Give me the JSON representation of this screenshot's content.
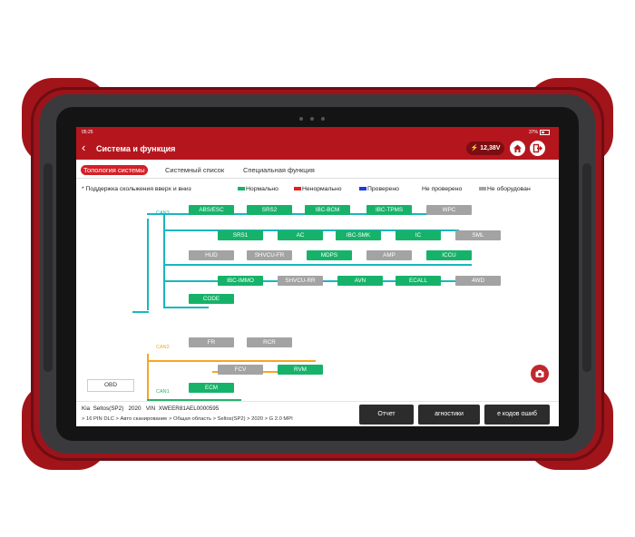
{
  "status": {
    "time": "05:25",
    "battery": "37%"
  },
  "header": {
    "title": "Система и функция",
    "voltage": "12,38V"
  },
  "tabs": [
    "Топология системы",
    "Системный список",
    "Специальная функция"
  ],
  "legend": {
    "hint": "* Поддержка скольжения вверх и вниз",
    "normal": "Нормально",
    "abnormal": "Ненормально",
    "checked": "Проверено",
    "unchecked": "Не проверено",
    "not_equipped": "Не оборудован"
  },
  "colors": {
    "normal": "#17b26a",
    "abnormal": "#e02020",
    "checked": "#1e3cd6",
    "not_equipped": "#a3a3a3",
    "accent": "#b5161e"
  },
  "bus": {
    "can3": "CAN3",
    "can2": "CAN2",
    "can1": "CAN1",
    "obd": "OBD"
  },
  "nodes": {
    "abs_esc": "ABS/ESC",
    "srs2": "SRS2",
    "ibc_bcm": "IBC-BCM",
    "ibc_tpms": "IBC-TPMS",
    "wpc": "WPC",
    "srs1": "SRS1",
    "ac": "AC",
    "ibc_smk": "IBC-SMK",
    "ic": "IC",
    "sml": "SML",
    "hud": "HUD",
    "shvcu_fr": "SHVCU-FR",
    "mdps": "MDPS",
    "amp": "AMP",
    "iccu": "ICCU",
    "ibc_immo": "IBC-IMMO",
    "shvcu_rr": "SHVCU-RR",
    "avn": "AVN",
    "ecall": "ECALL",
    "4wd": "4WD",
    "code": "CODE",
    "fr": "FR",
    "rcr": "RCR",
    "fcv": "FCV",
    "rvm": "RVM",
    "ecm": "ECM"
  },
  "vehicle": {
    "make": "Kia",
    "model": "Seltos(SP2)",
    "year": "2020",
    "vin_label": "VIN",
    "vin": "XWEER81AEL0000595"
  },
  "path": "> 16 PIN DLC > Авто сканирование > Общая область > Seltos(SP2) > 2020 > G 2.0 MPI",
  "buttons": {
    "report": "Отчет",
    "diagnostics": "агностики",
    "clear_codes": "е кодов ошиб"
  },
  "icons": [
    "back-arrow-icon",
    "battery-voltage-icon",
    "home-icon",
    "exit-icon",
    "camera-icon"
  ]
}
